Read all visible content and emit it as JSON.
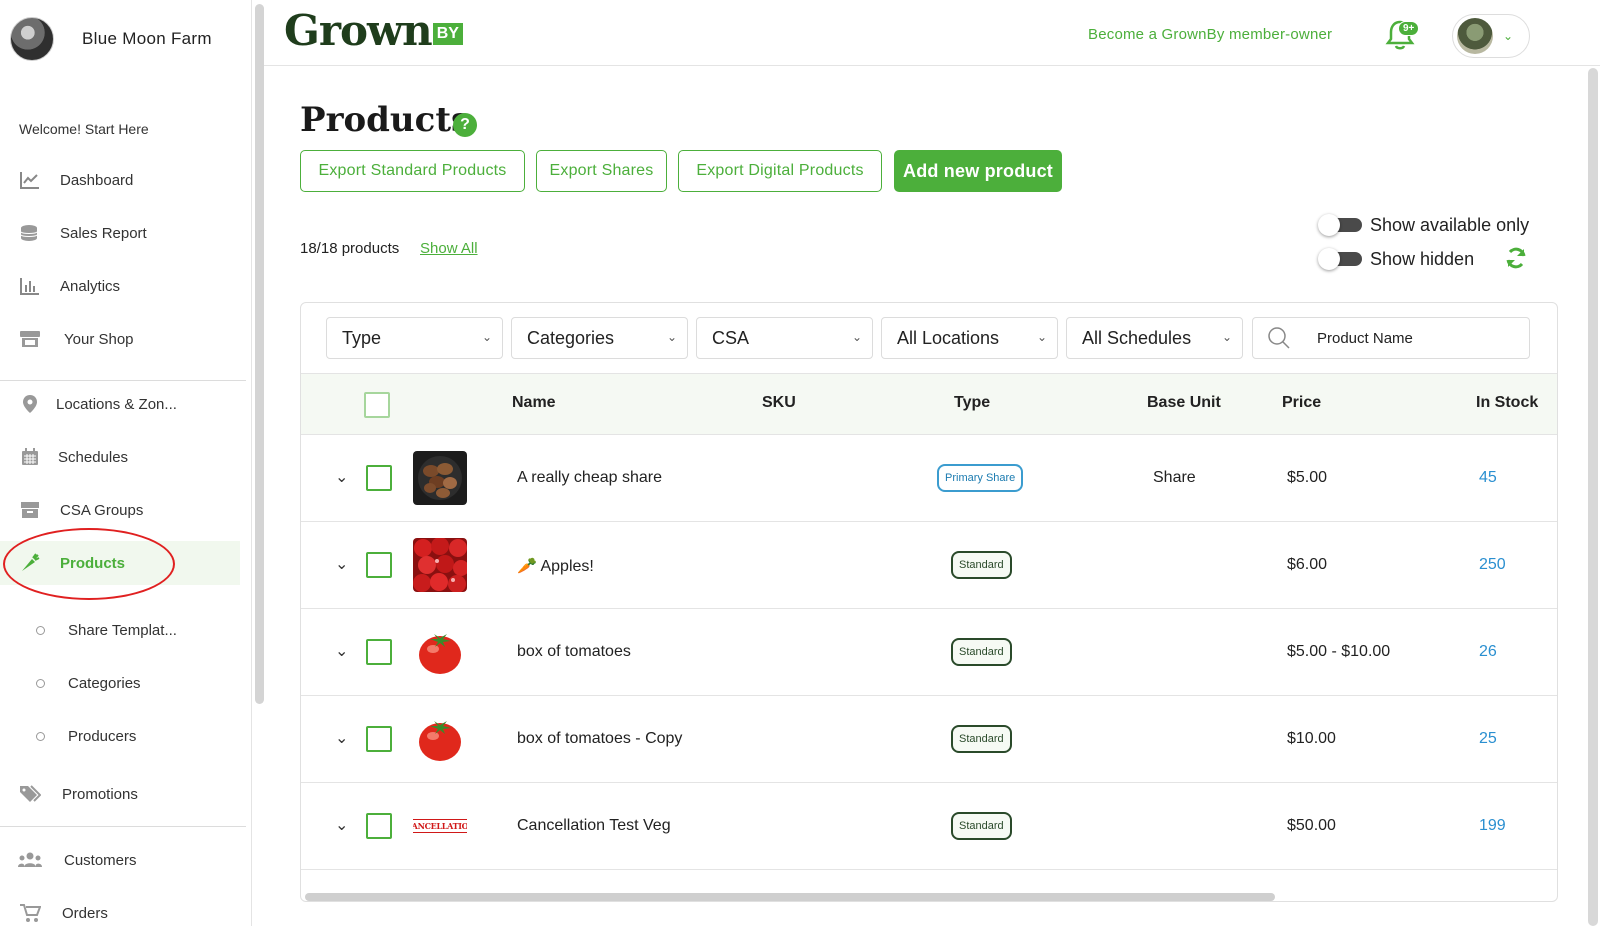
{
  "sidebar": {
    "farm_name": "Blue Moon Farm",
    "welcome": "Welcome! Start Here",
    "items": [
      {
        "label": "Dashboard",
        "icon": "chart-line-icon"
      },
      {
        "label": "Sales Report",
        "icon": "coins-icon"
      },
      {
        "label": "Analytics",
        "icon": "bar-chart-icon"
      },
      {
        "label": "Your Shop",
        "icon": "store-icon"
      },
      {
        "label": "Locations & Zon...",
        "icon": "map-pin-icon"
      },
      {
        "label": "Schedules",
        "icon": "calendar-icon"
      },
      {
        "label": "CSA Groups",
        "icon": "box-icon"
      },
      {
        "label": "Products",
        "icon": "carrot-icon",
        "active": true
      },
      {
        "label": "Promotions",
        "icon": "tags-icon"
      },
      {
        "label": "Customers",
        "icon": "users-icon"
      },
      {
        "label": "Orders",
        "icon": "cart-icon"
      }
    ],
    "sub_items": [
      "Share Templat...",
      "Categories",
      "Producers"
    ]
  },
  "header": {
    "logo_text": "Grown",
    "logo_by": "BY",
    "member_link": "Become a GrownBy member-owner",
    "notifications_badge": "9+"
  },
  "main": {
    "title": "Products",
    "help": "?",
    "buttons": {
      "export_standard": "Export Standard Products",
      "export_shares": "Export Shares",
      "export_digital": "Export Digital Products",
      "add_new": "Add new product"
    },
    "count": "18/18 products",
    "show_all": "Show All",
    "toggles": {
      "available_only": "Show available only",
      "hidden": "Show hidden"
    },
    "filters": {
      "type": "Type",
      "categories": "Categories",
      "csa": "CSA",
      "locations": "All Locations",
      "schedules": "All Schedules",
      "search_placeholder": "Product Name"
    },
    "columns": [
      "Name",
      "SKU",
      "Type",
      "Base Unit",
      "Price",
      "In Stock"
    ],
    "rows": [
      {
        "name": "A really cheap share",
        "type": "Primary Share",
        "unit": "Share",
        "price": "$5.00",
        "stock": "45",
        "image": "mushrooms"
      },
      {
        "name": "Apples!",
        "type": "Standard",
        "unit": "",
        "price": "$6.00",
        "stock": "250",
        "image": "apples"
      },
      {
        "name": "box of tomatoes",
        "type": "Standard",
        "unit": "",
        "price": "$5.00 - $10.00",
        "stock": "26",
        "image": "tomato"
      },
      {
        "name": "box of tomatoes - Copy",
        "type": "Standard",
        "unit": "",
        "price": "$10.00",
        "stock": "25",
        "image": "tomato"
      },
      {
        "name": "Cancellation Test Veg",
        "type": "Standard",
        "unit": "",
        "price": "$50.00",
        "stock": "199",
        "image": "cancelled-stamp",
        "image_text": "ANCELLATIO"
      }
    ]
  },
  "colors": {
    "accent": "#4caf3b",
    "link_blue": "#2a8fd0",
    "logo_dark": "#1f3d1c"
  }
}
